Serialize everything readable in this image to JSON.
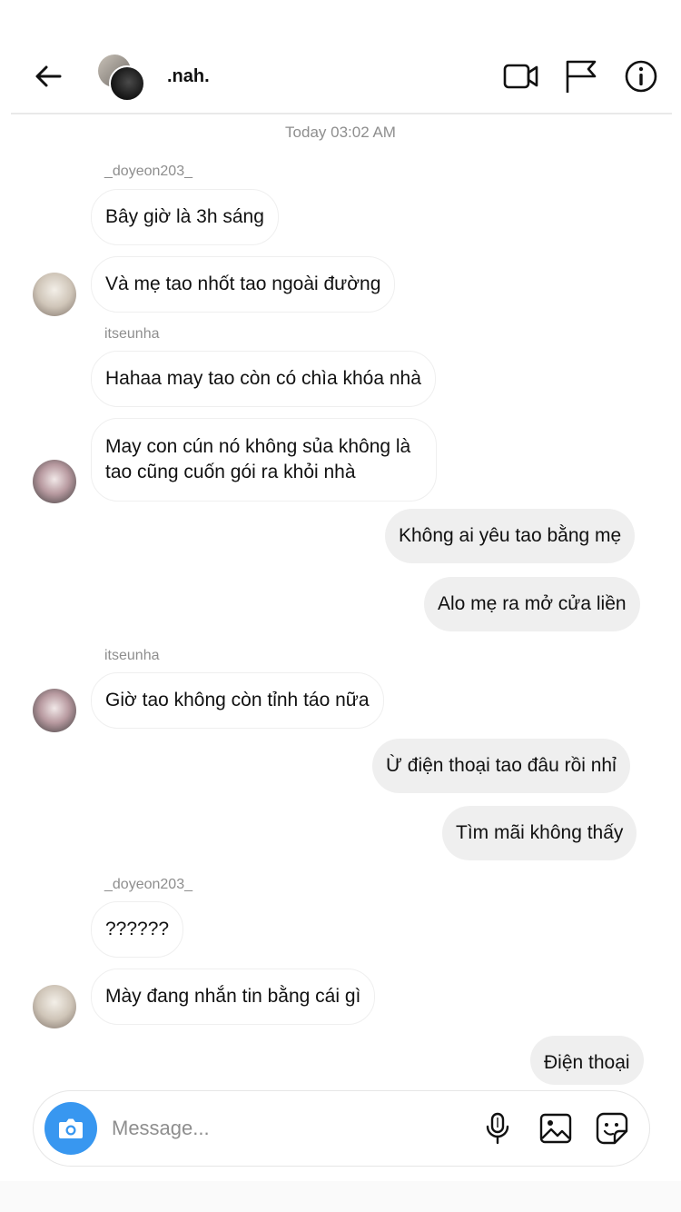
{
  "header": {
    "username": ".nah."
  },
  "timestamp": "Today 03:02 AM",
  "messages": [
    {
      "sender": "_doyeon203_",
      "text": "Bây giờ là 3h sáng"
    },
    {
      "text": "Và mẹ tao nhốt tao ngoài đường"
    },
    {
      "sender": "itseunha",
      "text": "Hahaa may tao còn có chìa khóa nhà"
    },
    {
      "text_line1": "May con cún nó không sủa không là",
      "text_line2": "tao cũng cuốn gói ra khỏi nhà"
    },
    {
      "text": "Không ai yêu tao bằng mẹ"
    },
    {
      "text": "Alo mẹ ra mở cửa liền"
    },
    {
      "sender": "itseunha",
      "text": "Giờ tao không còn tỉnh táo nữa"
    },
    {
      "text": "Ừ điện thoại tao đâu rồi nhỉ"
    },
    {
      "text": "Tìm mãi không thấy"
    },
    {
      "sender": "_doyeon203_",
      "text": "??????"
    },
    {
      "text": "Mày đang nhắn tin bằng cái gì"
    },
    {
      "text": "Điện thoại"
    }
  ],
  "composer": {
    "placeholder": "Message..."
  },
  "icons": {
    "back": "arrow-left-icon",
    "video": "video-camera-icon",
    "flag": "flag-icon",
    "info": "info-icon",
    "camera": "camera-icon",
    "mic": "microphone-icon",
    "gallery": "gallery-icon",
    "sticker": "sticker-icon"
  },
  "colors": {
    "accent": "#3897f0",
    "outgoing_bubble": "#efefef",
    "muted_text": "#8e8e8e"
  }
}
